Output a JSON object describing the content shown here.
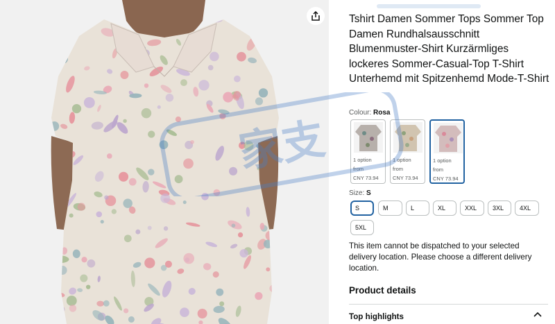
{
  "product": {
    "title": "Tshirt Damen Sommer Tops Sommer Top Damen Rundhalsausschnitt Blumenmuster-Shirt Kurzärmliges lockeres Sommer-Casual-Top T-Shirt Unterhemd mit Spitzenhemd Mode-T-Shirt"
  },
  "image": {
    "share_icon": "share-icon",
    "watermark_text": "家支"
  },
  "colour": {
    "label": "Colour:",
    "selected": "Rosa",
    "swatches": [
      {
        "option": "1 option",
        "from": "from",
        "price": "CNY 73.94",
        "color": "#b9a9a6"
      },
      {
        "option": "1 option",
        "from": "from",
        "price": "CNY 73.94",
        "color": "#c9b9a4"
      },
      {
        "option": "1 option",
        "from": "from",
        "price": "CNY 73.94",
        "color": "#c9a6a8"
      }
    ]
  },
  "size": {
    "label": "Size:",
    "selected": "S",
    "options": [
      "S",
      "M",
      "L",
      "XL",
      "XXL",
      "3XL",
      "4XL",
      "5XL"
    ]
  },
  "notice": "This item cannot be dispatched to your selected delivery location. Please choose a different delivery location.",
  "product_details_heading": "Product details",
  "top_highlights": {
    "label": "Top highlights",
    "icon": "chevron-up-icon"
  },
  "colors": {
    "accent": "#2162a1",
    "text": "#0f1111",
    "muted": "#565959",
    "border": "#bbbfbf"
  }
}
